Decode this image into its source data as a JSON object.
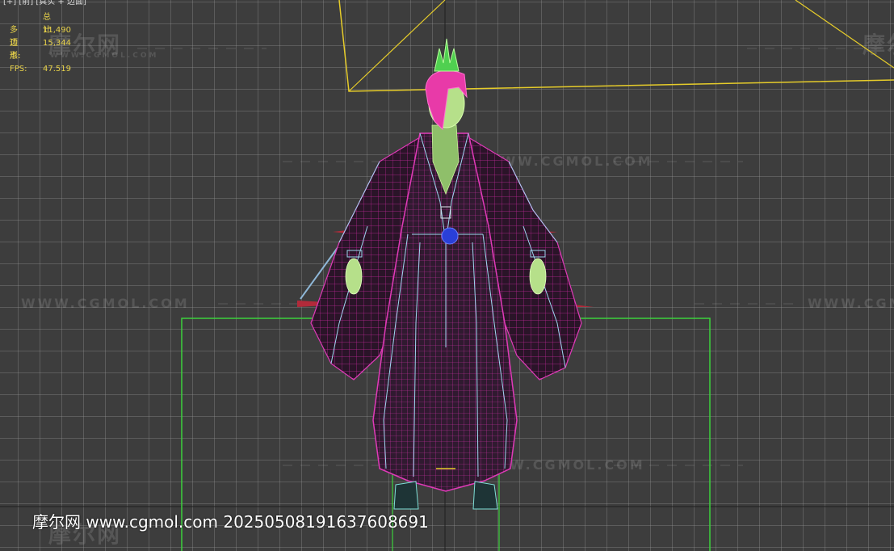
{
  "viewport": {
    "menu_label": "[+] [前] [真实 + 边面]"
  },
  "stats": {
    "heading": "总计",
    "polys_label": "多边形:",
    "polys_value": "11,490",
    "verts_label": "顶点:",
    "verts_value": "15,344",
    "fps_label": "FPS:",
    "fps_value": "47.519"
  },
  "watermarks": {
    "url": "WWW.CGMOL.COM",
    "logo": "摩尔网"
  },
  "caption": {
    "text": "摩尔网 www.cgmol.com 20250508191637608691"
  },
  "colors": {
    "camera_frustum": "#e6cc2a",
    "selection_box": "#3cd23c",
    "robe_wire": "#d4209c",
    "trim_wire": "#9fd6f0",
    "skin": "#b6e08a",
    "hair": "#e83aa8",
    "stats_text": "#e8d24a"
  }
}
